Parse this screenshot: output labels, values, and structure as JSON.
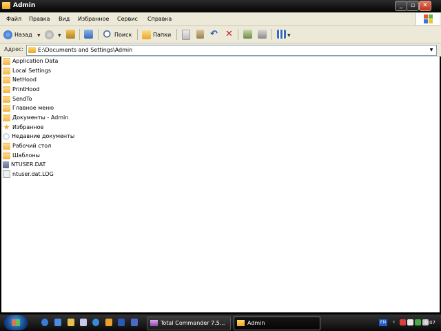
{
  "window": {
    "title": "Admin"
  },
  "menu": [
    "Файл",
    "Правка",
    "Вид",
    "Избранное",
    "Сервис",
    "Справка"
  ],
  "toolbar": {
    "back_label": "Назад",
    "search_label": "Поиск",
    "folders_label": "Папки"
  },
  "address": {
    "label": "Адрес:",
    "value": "E:\\Documents and Settings\\Admin"
  },
  "files": [
    {
      "name": "Application Data",
      "icon": "folder-icon"
    },
    {
      "name": "Local Settings",
      "icon": "folder-icon"
    },
    {
      "name": "NetHood",
      "icon": "folder-icon"
    },
    {
      "name": "PrintHood",
      "icon": "folder-icon"
    },
    {
      "name": "SendTo",
      "icon": "folder-icon"
    },
    {
      "name": "Главное меню",
      "icon": "folder-icon"
    },
    {
      "name": "Документы - Admin",
      "icon": "folder-icon"
    },
    {
      "name": "Избранное",
      "icon": "star-icon"
    },
    {
      "name": "Недавние документы",
      "icon": "recent-docs-icon"
    },
    {
      "name": "Рабочий стол",
      "icon": "folder-icon"
    },
    {
      "name": "Шаблоны",
      "icon": "folder-icon"
    },
    {
      "name": "NTUSER.DAT",
      "icon": "dat-file-icon"
    },
    {
      "name": "ntuser.dat.LOG",
      "icon": "file-icon"
    }
  ],
  "taskbar": {
    "tasks": [
      {
        "label": "Total Commander 7.5...",
        "active": false
      },
      {
        "label": "Admin",
        "active": true
      }
    ],
    "lang": "EN",
    "clock": "0:07"
  },
  "colors": {
    "titlebar": "#1a1a1a",
    "chrome": "#ece9d8",
    "list_bg": "#ffffff",
    "taskbar": "#1a1a1a"
  }
}
